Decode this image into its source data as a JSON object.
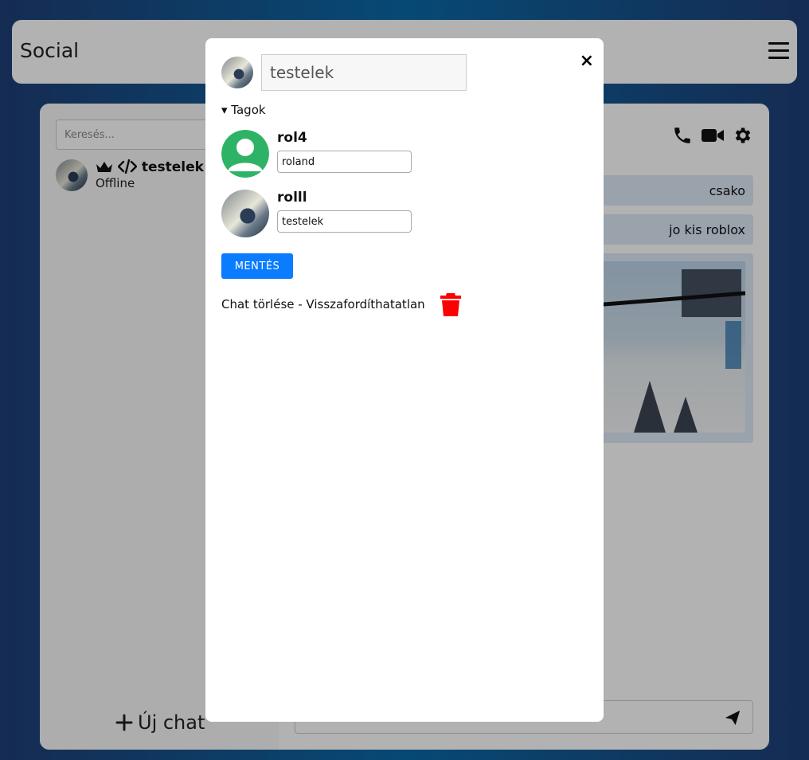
{
  "navbar": {
    "brand": "Social"
  },
  "sidebar": {
    "search_placeholder": "Keresés...",
    "chat": {
      "name": "testelek",
      "status": "Offline"
    },
    "new_chat_label": "Új chat"
  },
  "messages": [
    {
      "text": "csako"
    },
    {
      "text": "jo kis roblox"
    }
  ],
  "modal": {
    "group_name": "testelek",
    "members_toggle": "▾ Tagok",
    "members": [
      {
        "username": "rol4",
        "nickname": "roland",
        "avatar": "default-avatar-icon"
      },
      {
        "username": "rolll",
        "nickname": "testelek",
        "avatar": "photo"
      }
    ],
    "save_label": "MENTÉS",
    "delete_label": "Chat törlése - Visszafordíthatatlan",
    "close_label": "×"
  },
  "colors": {
    "accent": "#0a7cff",
    "danger": "#ff0000",
    "default_avatar": "#2eb366",
    "message_bg": "#dde8f5"
  }
}
